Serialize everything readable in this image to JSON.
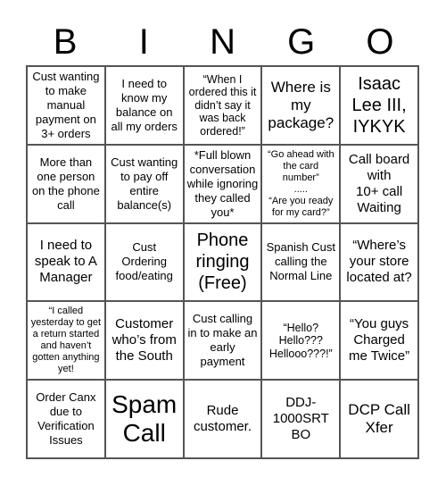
{
  "header": {
    "letters": [
      "B",
      "I",
      "N",
      "G",
      "O"
    ]
  },
  "board": {
    "rows": [
      [
        "Cust wanting to make manual payment on 3+ orders",
        "I need to know my balance on all my orders",
        "“When I ordered this it didn’t say it was back ordered!”",
        "Where is my package?",
        "Isaac Lee III, IYKYK"
      ],
      [
        "More than one person on the phone call",
        "Cust wanting to pay off entire balance(s)",
        "*Full blown conversation while ignoring they called you*",
        "“Go ahead with the card number”\n.....\n“Are you ready for my card?”",
        "Call board with\n10+ call Waiting"
      ],
      [
        "I need to speak to A Manager",
        "Cust Ordering food/eating",
        "Phone ringing (Free)",
        "Spanish Cust calling the Normal Line",
        "“Where’s your store located at?"
      ],
      [
        "“I called yesterday to get a return started and haven’t gotten anything yet!",
        "Customer who’s from the South",
        "Cust calling in to make an early payment",
        "“Hello?\nHello???\nHellooo???!”",
        "“You guys Charged me Twice”"
      ],
      [
        "Order Canx due to Verification Issues",
        "Spam Call",
        "Rude customer.",
        "DDJ-1000SRT BO",
        "DCP Call Xfer"
      ]
    ],
    "free_space": "Phone ringing (Free)"
  }
}
